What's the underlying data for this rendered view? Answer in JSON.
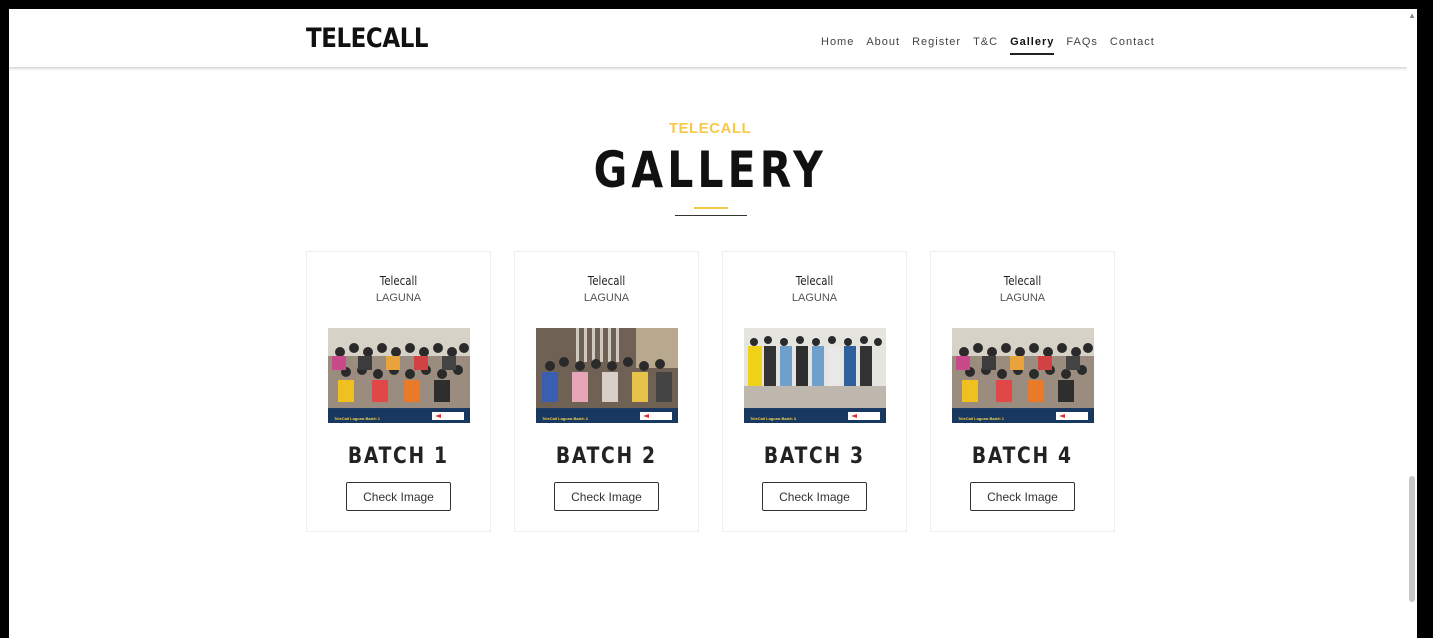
{
  "brand": "TELECALL",
  "nav": [
    {
      "label": "Home",
      "active": false
    },
    {
      "label": "About",
      "active": false
    },
    {
      "label": "Register",
      "active": false
    },
    {
      "label": "T&C",
      "active": false
    },
    {
      "label": "Gallery",
      "active": true
    },
    {
      "label": "FAQs",
      "active": false
    },
    {
      "label": "Contact",
      "active": false
    }
  ],
  "section": {
    "eyebrow": "TELECALL",
    "title": "GALLERY"
  },
  "cards": [
    {
      "title": "Telecall",
      "subtitle": "LAGUNA",
      "photo_caption": "TeleCall Laguna Batch 1",
      "batch": "BATCH 1",
      "button": "Check Image"
    },
    {
      "title": "Telecall",
      "subtitle": "LAGUNA",
      "photo_caption": "TeleCall Laguna Batch 2",
      "batch": "BATCH 2",
      "button": "Check Image"
    },
    {
      "title": "Telecall",
      "subtitle": "LAGUNA",
      "photo_caption": "TeleCall Laguna Batch 3",
      "batch": "BATCH 3",
      "button": "Check Image"
    },
    {
      "title": "Telecall",
      "subtitle": "LAGUNA",
      "photo_caption": "TeleCall Laguna Batch 1",
      "batch": "BATCH 4",
      "button": "Check Image"
    }
  ],
  "colors": {
    "accent": "#f7c948",
    "text": "#111111",
    "photo_bar": "#19385f"
  }
}
